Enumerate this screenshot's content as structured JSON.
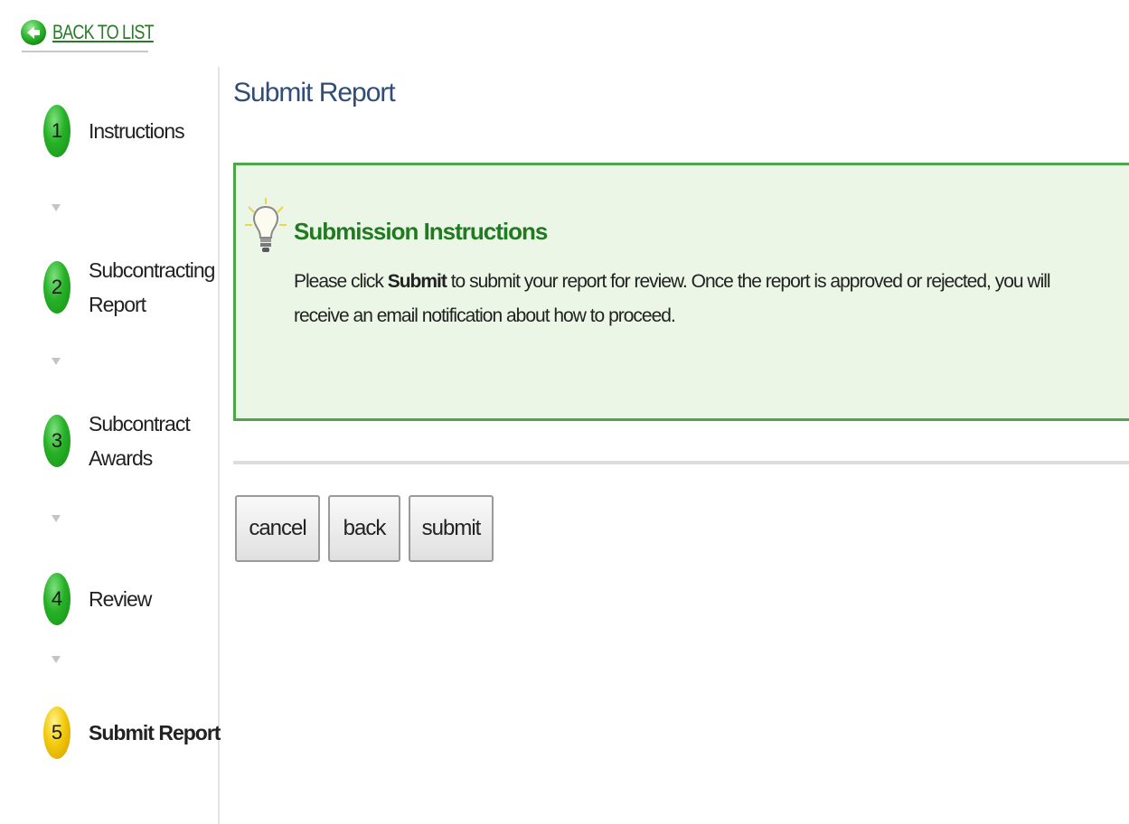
{
  "back_link": {
    "label": "BACK TO LIST",
    "icon": "back-arrow-icon"
  },
  "sidebar": {
    "steps": [
      {
        "number": "1",
        "label": "Instructions",
        "status": "complete",
        "color": "#27b127"
      },
      {
        "number": "2",
        "label": "Subcontracting Report",
        "status": "complete",
        "color": "#27b127"
      },
      {
        "number": "3",
        "label": "Subcontract Awards",
        "status": "complete",
        "color": "#27b127"
      },
      {
        "number": "4",
        "label": "Review",
        "status": "complete",
        "color": "#27b127"
      },
      {
        "number": "5",
        "label": "Submit Report",
        "status": "current",
        "color": "#f2c90c"
      }
    ]
  },
  "main": {
    "title": "Submit Report",
    "instructions": {
      "icon": "lightbulb-icon",
      "heading": "Submission Instructions",
      "text_before": "Please click ",
      "text_bold": "Submit",
      "text_after": " to submit your report for review. Once the report is approved or rejected, you will receive an email notification about how to proceed."
    },
    "buttons": {
      "cancel": "cancel",
      "back": "back",
      "submit": "submit"
    }
  },
  "colors": {
    "accent_green": "#4ea64b",
    "box_background": "#ebf6e6",
    "title_blue": "#2f4d78"
  }
}
